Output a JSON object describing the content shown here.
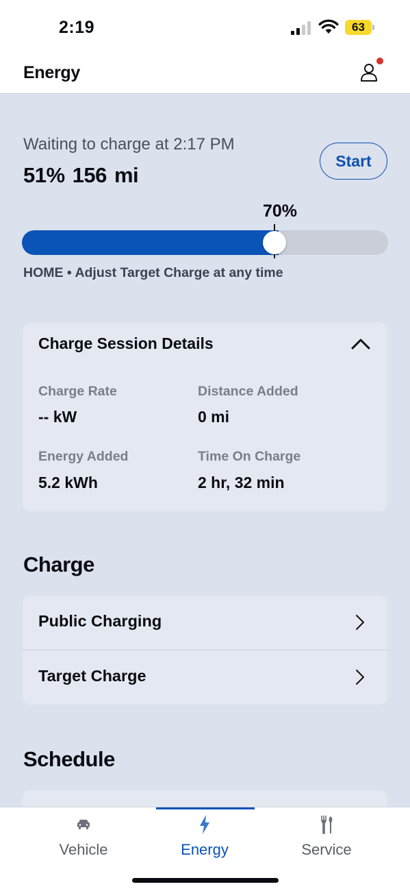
{
  "status_bar": {
    "time": "2:19",
    "battery": "63"
  },
  "header": {
    "title": "Energy"
  },
  "charging": {
    "status": "Waiting to charge at 2:17 PM",
    "level": "51%  156 mi",
    "battery_fraction": 0.7,
    "target_label": "70%",
    "start_label": "Start",
    "location_note": "HOME • Adjust Target Charge at any time"
  },
  "session": {
    "title": "Charge Session Details",
    "details": [
      {
        "label": "Charge Rate",
        "value": "-- kW"
      },
      {
        "label": "Distance Added",
        "value": "0 mi"
      },
      {
        "label": "Energy Added",
        "value": "5.2 kWh"
      },
      {
        "label": "Time On Charge",
        "value": "2 hr, 32 min"
      }
    ]
  },
  "charge_section": {
    "heading": "Charge",
    "items": [
      {
        "label": "Public Charging"
      },
      {
        "label": "Target Charge"
      }
    ]
  },
  "schedule_section": {
    "heading": "Schedule"
  },
  "tabs": [
    {
      "label": "Vehicle",
      "icon": "car-icon",
      "active": false
    },
    {
      "label": "Energy",
      "icon": "lightning-icon",
      "active": true
    },
    {
      "label": "Service",
      "icon": "tools-icon",
      "active": false
    }
  ],
  "colors": {
    "accent": "#0a54b8",
    "background": "#dbe2ed",
    "card": "#e3e8f1",
    "notification": "#d9342b"
  }
}
